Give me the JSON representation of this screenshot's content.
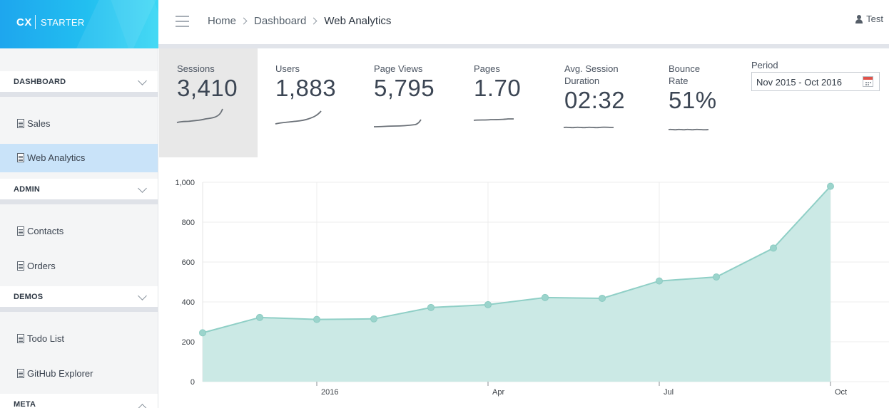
{
  "brand": {
    "short": "CX",
    "name": "STARTER"
  },
  "header": {
    "breadcrumb": [
      "Home",
      "Dashboard",
      "Web Analytics"
    ],
    "user": "Test"
  },
  "sidebar": {
    "sections": [
      {
        "label": "DASHBOARD",
        "items": [
          {
            "label": "Sales",
            "active": false
          },
          {
            "label": "Web Analytics",
            "active": true
          }
        ]
      },
      {
        "label": "ADMIN",
        "items": [
          {
            "label": "Contacts",
            "active": false
          },
          {
            "label": "Orders",
            "active": false
          }
        ]
      },
      {
        "label": "DEMOS",
        "items": [
          {
            "label": "Todo List",
            "active": false
          },
          {
            "label": "GitHub Explorer",
            "active": false
          }
        ]
      },
      {
        "label": "META",
        "items": []
      }
    ]
  },
  "kpis": [
    {
      "label": "Sessions",
      "value": "3,410",
      "active": true
    },
    {
      "label": "Users",
      "value": "1,883",
      "active": false
    },
    {
      "label": "Page Views",
      "value": "5,795",
      "active": false
    },
    {
      "label": "Pages",
      "value": "1.70",
      "active": false
    },
    {
      "label": "Avg. Session Duration",
      "value": "02:32",
      "active": false
    },
    {
      "label": "Bounce Rate",
      "value": "51%",
      "active": false
    }
  ],
  "period": {
    "label": "Period",
    "value": "Nov 2015 - Oct 2016"
  },
  "colors": {
    "accent": "#22bff0",
    "area_fill": "#cbe9e5",
    "area_line": "#8fcfc6",
    "active_nav": "#c9e3f9"
  },
  "chart_data": {
    "type": "area",
    "x": [
      "2015-11",
      "2015-12",
      "2016-01",
      "2016-02",
      "2016-03",
      "2016-04",
      "2016-05",
      "2016-06",
      "2016-07",
      "2016-08",
      "2016-09",
      "2016-10"
    ],
    "series": [
      {
        "values": [
          245,
          322,
          312,
          315,
          372,
          386,
          422,
          418,
          505,
          525,
          670,
          980
        ]
      }
    ],
    "y_ticks": [
      "0",
      "200",
      "400",
      "600",
      "800",
      "1,000"
    ],
    "x_ticks": [
      "2016",
      "Apr",
      "Jul",
      "Oct"
    ],
    "ylim": [
      0,
      1000
    ],
    "grid": true
  }
}
